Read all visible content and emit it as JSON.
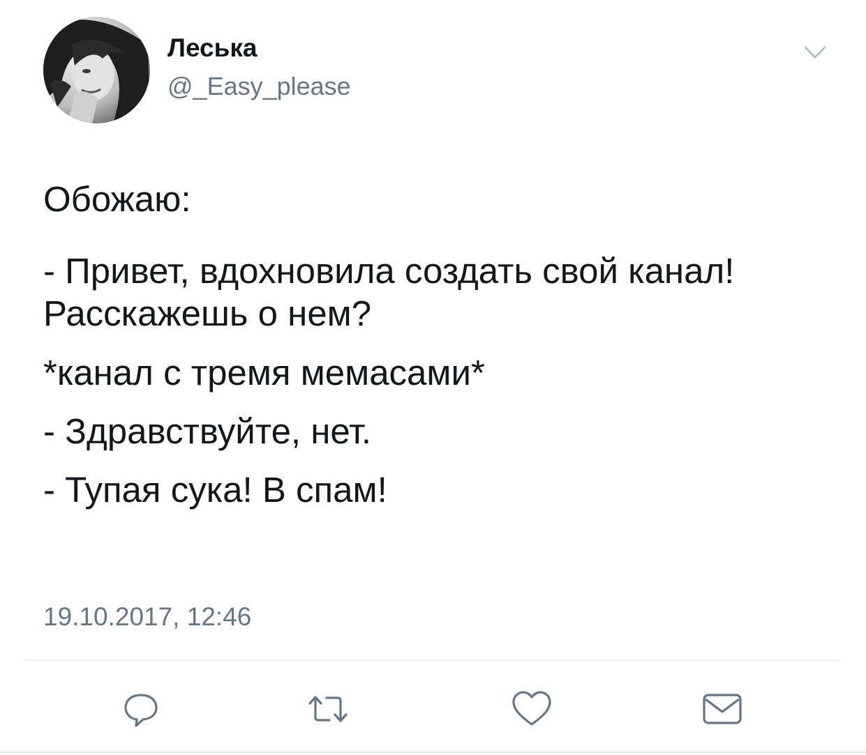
{
  "author": {
    "display_name": "Леська",
    "handle": "@_Easy_please",
    "avatar_icon": "profile-photo"
  },
  "tweet": {
    "intro": "Обожаю:",
    "lines": [
      "- Привет, вдохновила создать свой канал! Расскажешь о нем?",
      "*канал с тремя мемасами*",
      "- Здравствуйте, нет.",
      "- Тупая сука! В спам!"
    ],
    "timestamp": "19.10.2017, 12:46"
  },
  "menu": {
    "icon": "chevron-down-icon"
  },
  "actions": [
    {
      "name": "reply",
      "icon": "reply-icon"
    },
    {
      "name": "retweet",
      "icon": "retweet-icon"
    },
    {
      "name": "like",
      "icon": "heart-icon"
    },
    {
      "name": "direct-message",
      "icon": "envelope-icon"
    }
  ],
  "colors": {
    "text_primary": "#14171a",
    "text_secondary": "#657786",
    "icon_gray": "#657786",
    "divider": "#e6ecf0"
  }
}
